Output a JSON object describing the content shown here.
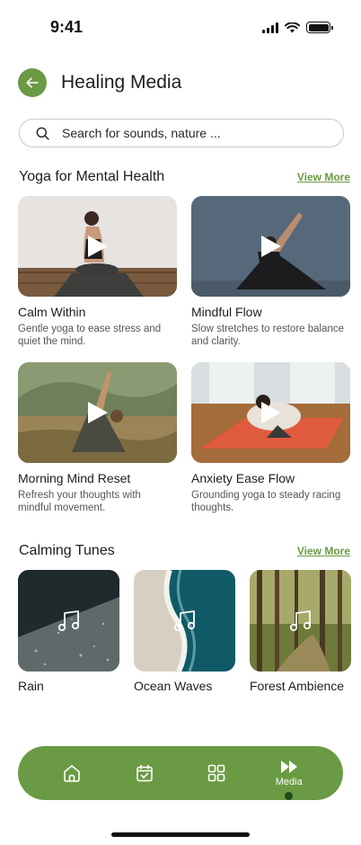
{
  "status_bar": {
    "time": "9:41"
  },
  "header": {
    "title": "Healing Media"
  },
  "search": {
    "placeholder": "Search for sounds, nature ..."
  },
  "yoga_section": {
    "title": "Yoga for Mental Health",
    "view_more": "View More",
    "cards": [
      {
        "title": "Calm Within",
        "description": "Gentle yoga to ease stress and quiet the mind."
      },
      {
        "title": "Mindful Flow",
        "description": "Slow stretches to restore balance and clarity."
      },
      {
        "title": "Morning Mind Reset",
        "description": "Refresh your thoughts with mindful movement."
      },
      {
        "title": "Anxiety Ease Flow",
        "description": "Grounding yoga to steady racing thoughts."
      }
    ]
  },
  "tunes_section": {
    "title": "Calming Tunes",
    "view_more": "View More",
    "items": [
      {
        "title": "Rain"
      },
      {
        "title": "Ocean Waves"
      },
      {
        "title": "Forest Ambience"
      }
    ]
  },
  "bottom_nav": {
    "active_label": "Media",
    "icons": [
      "home-icon",
      "calendar-check-icon",
      "grid-icon",
      "fast-forward-icon"
    ]
  },
  "colors": {
    "accent": "#6a9a43",
    "active_dot": "#1f4a1a"
  }
}
